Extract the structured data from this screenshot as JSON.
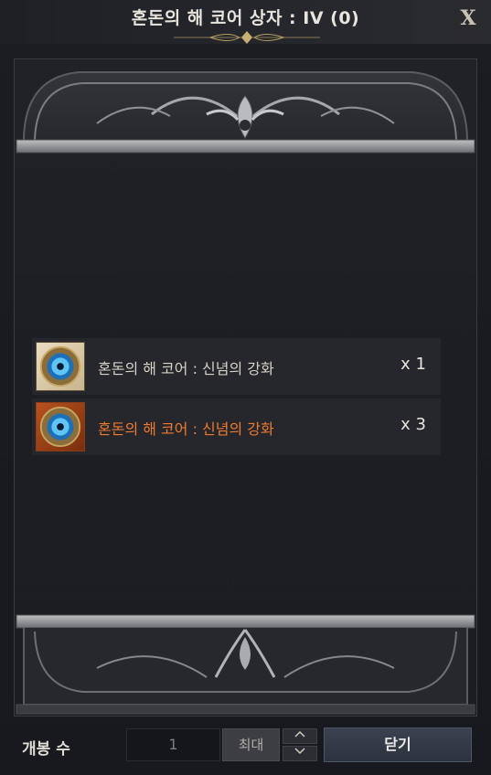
{
  "window": {
    "title": "혼돈의 해 코어 상자 : IV (0)",
    "close_label": "X"
  },
  "items": [
    {
      "name": "혼돈의 해 코어 : 신념의 강화",
      "quantity": "x 1",
      "grade": "rare",
      "name_color": "#d8d2c6",
      "icon": "sun-core-icon"
    },
    {
      "name": "혼돈의 해 코어 : 신념의 강화",
      "quantity": "x 3",
      "grade": "epic",
      "name_color": "#f07a2c",
      "icon": "sun-core-icon"
    }
  ],
  "controls": {
    "open_count_label": "개봉 수",
    "quantity_value": "1",
    "max_label": "최대",
    "close_label": "닫기"
  },
  "colors": {
    "accent_orange": "#f07a2c",
    "button_blue": "#3a4250",
    "frame_silver": "#8c8e92"
  }
}
